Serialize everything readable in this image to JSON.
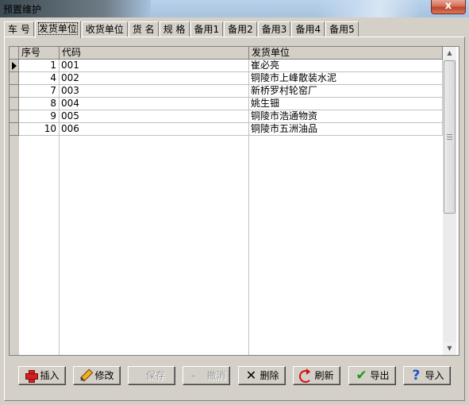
{
  "window": {
    "title": "预置维护",
    "close_label": "x"
  },
  "tabs": [
    {
      "label": "车  号"
    },
    {
      "label": "发货单位"
    },
    {
      "label": "收货单位"
    },
    {
      "label": "货  名"
    },
    {
      "label": "规  格"
    },
    {
      "label": "备用1"
    },
    {
      "label": "备用2"
    },
    {
      "label": "备用3"
    },
    {
      "label": "备用4"
    },
    {
      "label": "备用5"
    }
  ],
  "active_tab": "发货单位",
  "grid": {
    "headers": {
      "seq": "序号",
      "code": "代码",
      "unit": "发货单位"
    },
    "rows": [
      {
        "seq": "1",
        "code": "001",
        "unit": "崔必亮"
      },
      {
        "seq": "4",
        "code": "002",
        "unit": "铜陵市上峰散装水泥"
      },
      {
        "seq": "7",
        "code": "003",
        "unit": "新桥罗村轮窑厂"
      },
      {
        "seq": "8",
        "code": "004",
        "unit": "姚生钿"
      },
      {
        "seq": "9",
        "code": "005",
        "unit": "铜陵市浩通物资"
      },
      {
        "seq": "10",
        "code": "006",
        "unit": "铜陵市五洲油品"
      }
    ]
  },
  "buttons": {
    "insert": "插入",
    "edit": "修改",
    "save": "保存",
    "cancel": "撤消",
    "delete": "删除",
    "refresh": "刷新",
    "export": "导出",
    "import": "导入"
  },
  "icons": {
    "insert": "plus-icon",
    "edit": "pencil-icon",
    "cancel": "minus-icon",
    "delete": "x-icon",
    "refresh": "refresh-icon",
    "export": "checkmark-icon",
    "import": "question-icon"
  }
}
